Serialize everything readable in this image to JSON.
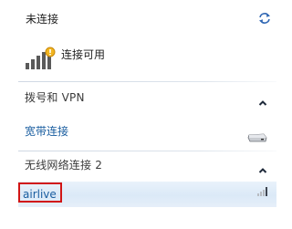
{
  "status": {
    "title": "未连接",
    "availability": "连接可用"
  },
  "sections": [
    {
      "label": "拨号和 VPN",
      "items": [
        {
          "label": "宽带连接",
          "icon": "modem-icon"
        }
      ]
    },
    {
      "label": "无线网络连接 2",
      "items": [
        {
          "label": "airlive",
          "icon": "wifi-strength-icon"
        }
      ]
    }
  ],
  "icons": {
    "refresh": "refresh-icon",
    "signal": "signal-bars-icon",
    "chevron": "chevron-up-icon"
  },
  "colors": {
    "link": "#1a5ea0",
    "highlight_border": "#d11515",
    "selected_row": "#dbe9f7",
    "signal_bar": "#e8a620"
  }
}
